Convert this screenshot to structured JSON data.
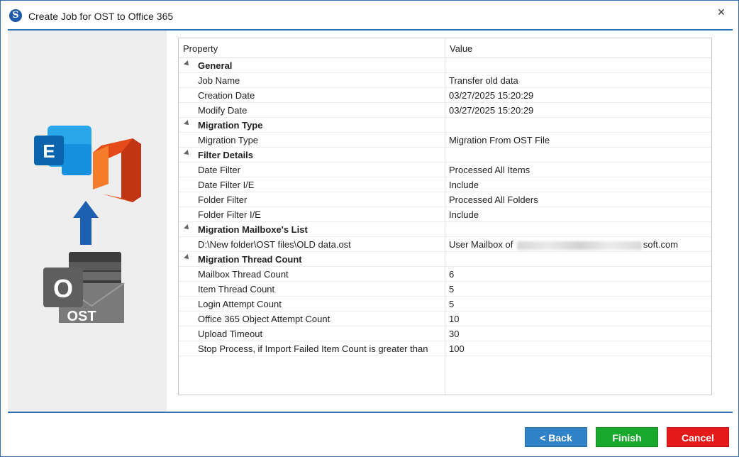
{
  "window": {
    "title": "Create Job for OST to Office 365",
    "app_icon_letter": "S",
    "close_glyph": "✕"
  },
  "illustration": {
    "exchange_letter": "E",
    "outlook_letter": "O",
    "ost_label": "OST"
  },
  "grid": {
    "header_property": "Property",
    "header_value": "Value",
    "rows": [
      {
        "type": "group",
        "label": "General",
        "value": ""
      },
      {
        "type": "item",
        "label": "Job Name",
        "value": "Transfer old data"
      },
      {
        "type": "item",
        "label": "Creation Date",
        "value": "03/27/2025 15:20:29"
      },
      {
        "type": "item",
        "label": "Modify Date",
        "value": "03/27/2025 15:20:29"
      },
      {
        "type": "group",
        "label": "Migration Type",
        "value": ""
      },
      {
        "type": "item",
        "label": "Migration Type",
        "value": "Migration From OST File"
      },
      {
        "type": "group",
        "label": "Filter Details",
        "value": ""
      },
      {
        "type": "item",
        "label": "Date Filter",
        "value": "Processed All Items"
      },
      {
        "type": "item",
        "label": "Date Filter I/E",
        "value": "Include"
      },
      {
        "type": "item",
        "label": "Folder Filter",
        "value": "Processed All Folders"
      },
      {
        "type": "item",
        "label": "Folder Filter I/E",
        "value": "Include"
      },
      {
        "type": "group",
        "label": "Migration Mailboxe's List",
        "value": ""
      },
      {
        "type": "mailbox",
        "label": "D:\\New folder\\OST files\\OLD data.ost",
        "value_prefix": "User Mailbox of ",
        "value_suffix": "soft.com"
      },
      {
        "type": "group",
        "label": "Migration Thread Count",
        "value": ""
      },
      {
        "type": "item",
        "label": "Mailbox Thread Count",
        "value": "6"
      },
      {
        "type": "item",
        "label": "Item Thread Count",
        "value": "5"
      },
      {
        "type": "item",
        "label": "Login Attempt Count",
        "value": "5"
      },
      {
        "type": "item",
        "label": "Office 365 Object Attempt Count",
        "value": "10"
      },
      {
        "type": "item",
        "label": "Upload Timeout",
        "value": "30"
      },
      {
        "type": "item",
        "label": "Stop Process, if Import Failed Item Count is greater than",
        "value": "100"
      }
    ]
  },
  "buttons": {
    "back": "< Back",
    "finish": "Finish",
    "cancel": "Cancel"
  },
  "colors": {
    "accent": "#2f6fb3",
    "back": "#2f82c6",
    "finish": "#17a82c",
    "cancel": "#e21a1a"
  }
}
